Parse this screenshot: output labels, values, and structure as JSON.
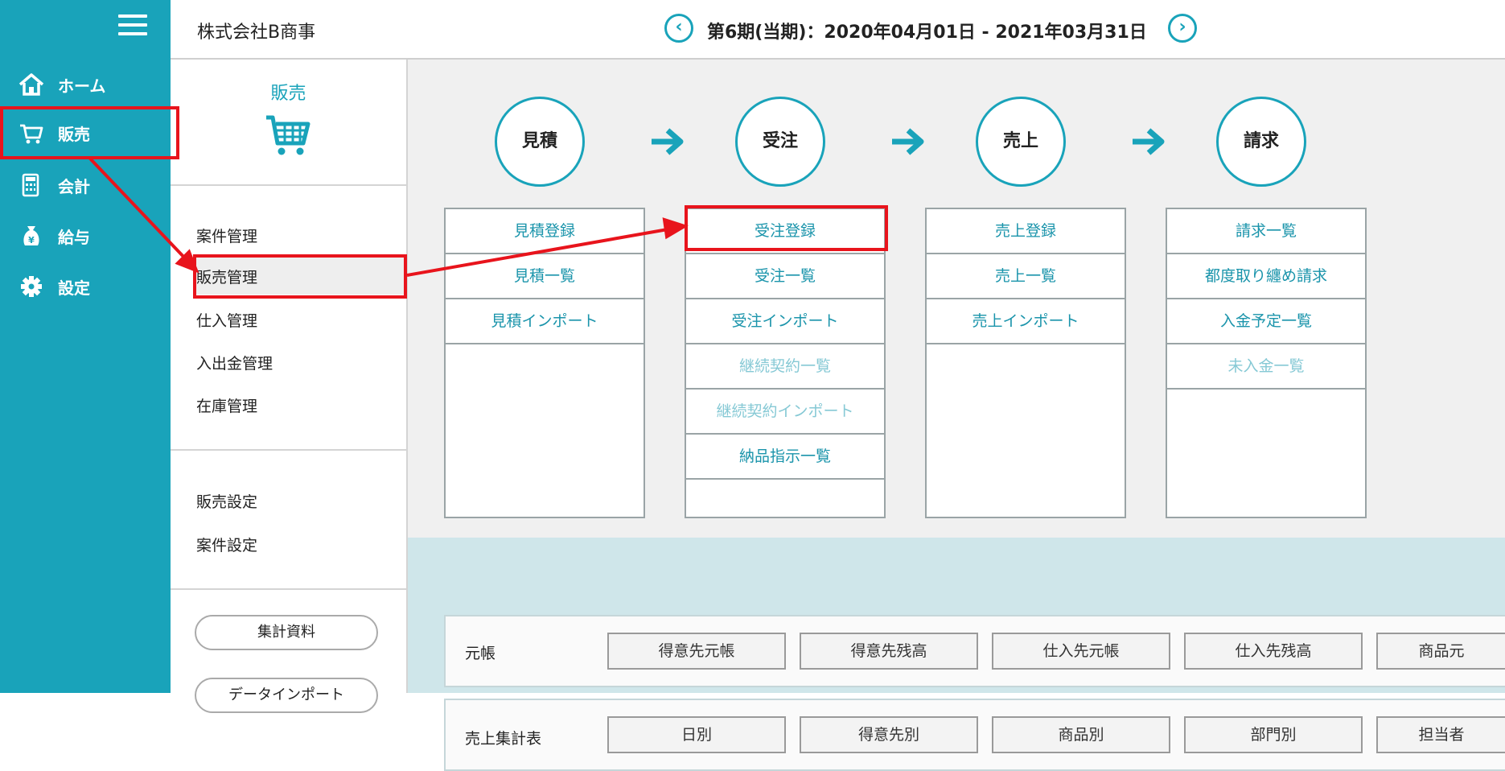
{
  "nav": {
    "items": [
      {
        "label": "ホーム",
        "icon": "home-icon"
      },
      {
        "label": "販売",
        "icon": "cart-icon"
      },
      {
        "label": "会計",
        "icon": "calculator-icon"
      },
      {
        "label": "給与",
        "icon": "money-bag-icon"
      },
      {
        "label": "設定",
        "icon": "gear-icon"
      }
    ],
    "active_index": 1
  },
  "header": {
    "company": "株式会社B商事",
    "period": "第6期(当期)：2020年04月01日 - 2021年03月31日",
    "prev_icon": "chevron-left-icon",
    "next_icon": "chevron-right-icon"
  },
  "submenu": {
    "title": "販売",
    "title_icon": "cart-icon",
    "items": [
      "案件管理",
      "販売管理",
      "仕入管理",
      "入出金管理",
      "在庫管理"
    ],
    "settings": [
      "販売設定",
      "案件設定"
    ],
    "buttons": [
      "集計資料",
      "データインポート"
    ],
    "active_index": 1
  },
  "flow": {
    "stages": [
      "見積",
      "受注",
      "売上",
      "請求"
    ],
    "columns": [
      {
        "cells": [
          {
            "label": "見積登録",
            "enabled": true
          },
          {
            "label": "見積一覧",
            "enabled": true
          },
          {
            "label": "見積インポート",
            "enabled": true
          }
        ]
      },
      {
        "cells": [
          {
            "label": "受注登録",
            "enabled": true
          },
          {
            "label": "受注一覧",
            "enabled": true
          },
          {
            "label": "受注インポート",
            "enabled": true
          },
          {
            "label": "継続契約一覧",
            "enabled": false
          },
          {
            "label": "継続契約インポート",
            "enabled": false
          },
          {
            "label": "納品指示一覧",
            "enabled": true
          }
        ]
      },
      {
        "cells": [
          {
            "label": "売上登録",
            "enabled": true
          },
          {
            "label": "売上一覧",
            "enabled": true
          },
          {
            "label": "売上インポート",
            "enabled": true
          }
        ]
      },
      {
        "cells": [
          {
            "label": "請求一覧",
            "enabled": true
          },
          {
            "label": "都度取り纏め請求",
            "enabled": true
          },
          {
            "label": "入金予定一覧",
            "enabled": true
          },
          {
            "label": "未入金一覧",
            "enabled": false
          }
        ]
      }
    ]
  },
  "reports": {
    "rows": [
      {
        "label": "元帳",
        "buttons": [
          "得意先元帳",
          "得意先残高",
          "仕入先元帳",
          "仕入先残高",
          "商品元"
        ]
      },
      {
        "label": "売上集計表",
        "buttons": [
          "日別",
          "得意先別",
          "商品別",
          "部門別",
          "担当者"
        ]
      }
    ]
  },
  "colors": {
    "accent": "#19a3ba",
    "highlight": "#e8141c",
    "disabled_link": "#86c9d5"
  }
}
